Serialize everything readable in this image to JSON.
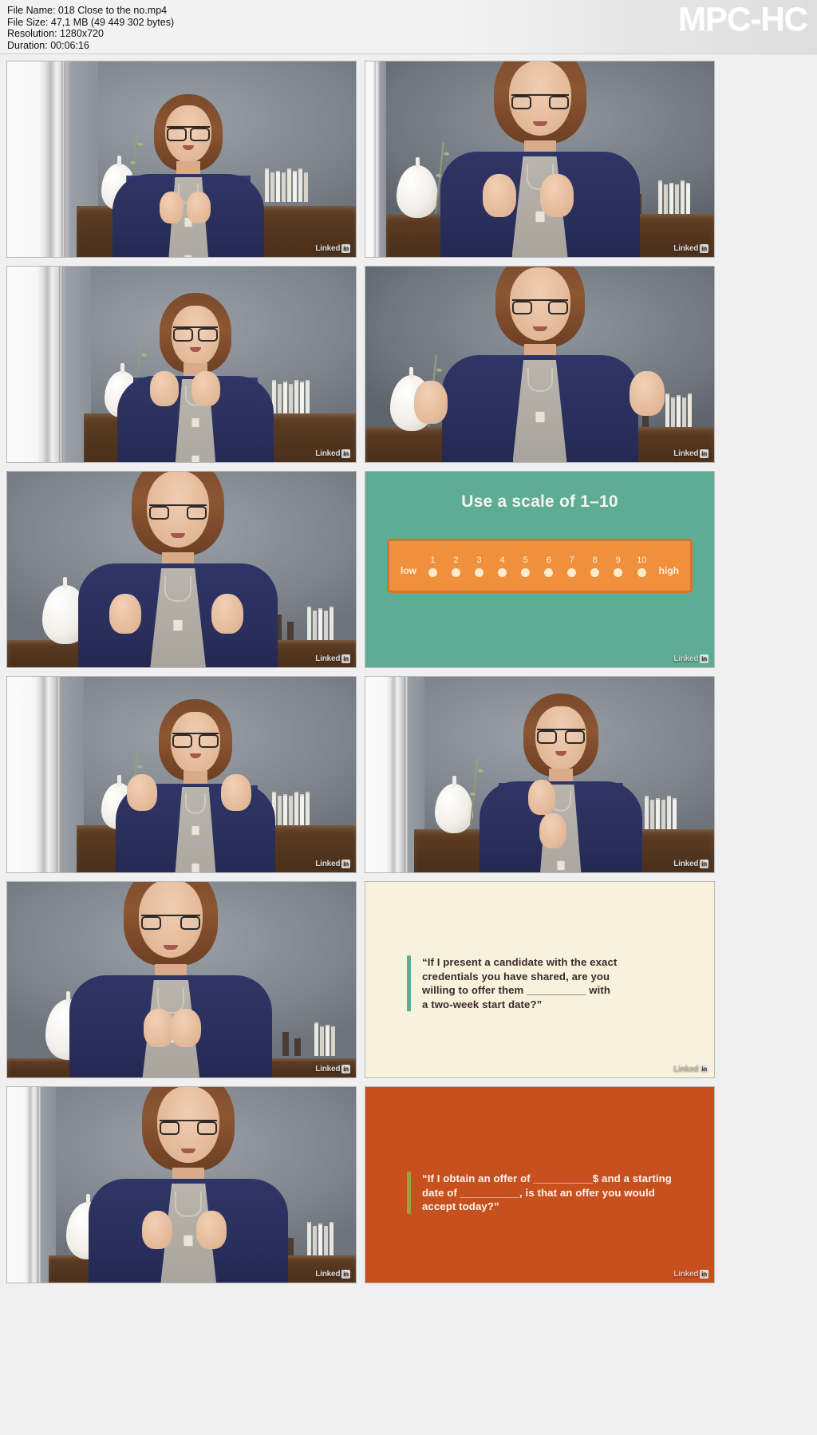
{
  "header": {
    "file_name": "File Name: 018 Close to the no.mp4",
    "file_size": "File Size: 47,1 MB (49 449 302 bytes)",
    "resolution": "Resolution: 1280x720",
    "duration": "Duration: 00:06:16",
    "app_name": "MPC-HC"
  },
  "watermark": {
    "text": "Linked",
    "badge": "in"
  },
  "slides": {
    "scale": {
      "title": "Use a scale of 1–10",
      "low_label": "low",
      "high_label": "high",
      "ticks": [
        "1",
        "2",
        "3",
        "4",
        "5",
        "6",
        "7",
        "8",
        "9",
        "10"
      ],
      "bar_color": "#f1903c",
      "bar_border_color": "#d9722a",
      "background_color": "#5eac94",
      "dot_color": "#fbeccc"
    },
    "quote_credentials": {
      "lines": [
        "“If I present a candidate with the exact",
        "credentials you have shared, are you",
        "willing to offer them __________ with",
        "a two-week start date?”"
      ],
      "background_color": "#f8f2dc",
      "accent_color": "#5eac94",
      "text_color": "#3a2b2b"
    },
    "quote_offer": {
      "lines": [
        "“If I obtain an offer of __________$ and a starting",
        "date of __________, is that an offer you would",
        "accept today?”"
      ],
      "background_color": "#c8501f",
      "accent_color": "#9aa33f",
      "text_color": "#fdf6ec"
    }
  },
  "grid": {
    "columns": 2,
    "rows": 6,
    "thumbnail_count": 12
  }
}
